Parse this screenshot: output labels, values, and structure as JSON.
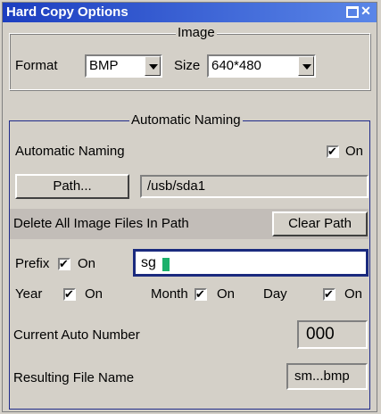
{
  "window": {
    "title": "Hard Copy Options"
  },
  "image_group": {
    "legend": "Image",
    "format_label": "Format",
    "format_value": "BMP",
    "size_label": "Size",
    "size_value": "640*480"
  },
  "auto_group": {
    "legend": "Automatic Naming",
    "auto_naming_label": "Automatic Naming",
    "auto_naming_on": "On",
    "path_button": "Path...",
    "path_value": "/usb/sda1",
    "delete_all_button": "Delete All Image Files In Path",
    "clear_path_button": "Clear Path",
    "prefix_label": "Prefix",
    "prefix_on": "On",
    "prefix_value": "sg",
    "year_label": "Year",
    "year_on": "On",
    "month_label": "Month",
    "month_on": "On",
    "day_label": "Day",
    "day_on": "On",
    "current_auto_number_label": "Current Auto Number",
    "current_auto_number_value": "000",
    "resulting_file_name_label": "Resulting File Name",
    "resulting_file_name_value": "sm...bmp"
  },
  "colors": {
    "title_bar": "#1c3ec0",
    "focus_border": "#1a2a7e",
    "caret": "#1cb06b"
  }
}
